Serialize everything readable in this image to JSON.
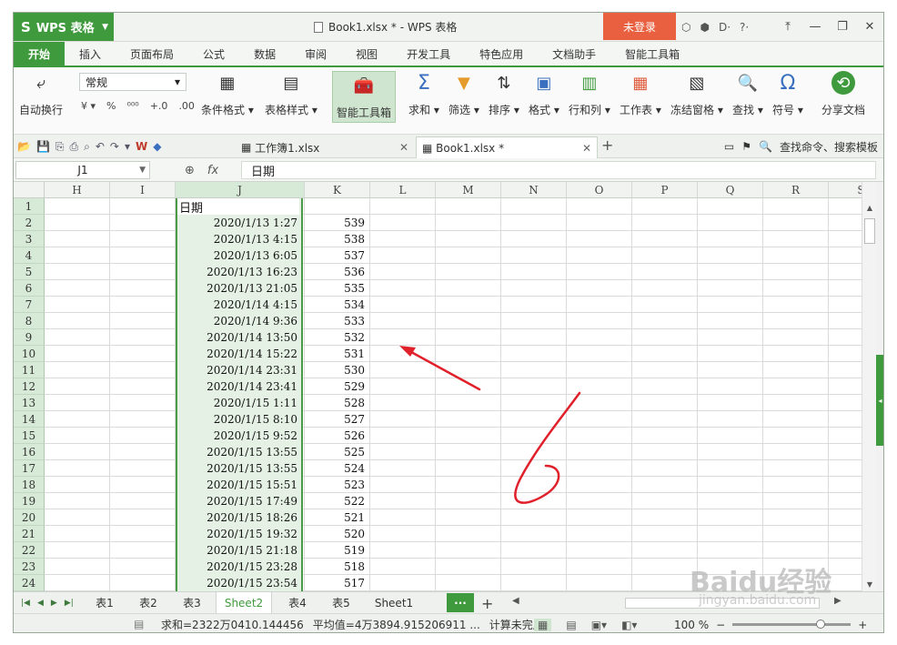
{
  "window": {
    "app_button": "WPS 表格",
    "title": "Book1.xlsx * - WPS 表格",
    "login_label": "未登录",
    "tool_glyphs": [
      "⬡",
      "⬢",
      "D·",
      "?·"
    ],
    "controls": [
      "⤒",
      "—",
      "❐",
      "✕"
    ]
  },
  "menu": {
    "tabs": [
      "开始",
      "插入",
      "页面布局",
      "公式",
      "数据",
      "审阅",
      "视图",
      "开发工具",
      "特色应用",
      "文档助手",
      "智能工具箱"
    ]
  },
  "ribbon": {
    "wrap_label": "自动换行",
    "number_format": "常规",
    "number_tools": [
      "¥ ▾",
      "%",
      "⁰⁰⁰",
      "+.0",
      ".00"
    ],
    "items": [
      {
        "label": "条件格式 ▾",
        "icon": "conditional-format-icon",
        "glyph": "▦"
      },
      {
        "label": "表格样式 ▾",
        "icon": "table-style-icon",
        "glyph": "▤"
      },
      {
        "label": "智能工具箱",
        "icon": "toolbox-icon",
        "glyph": "🧰"
      },
      {
        "label": "求和 ▾",
        "icon": "sum-icon",
        "glyph": "Σ"
      },
      {
        "label": "筛选 ▾",
        "icon": "filter-icon",
        "glyph": "▼"
      },
      {
        "label": "排序 ▾",
        "icon": "sort-icon",
        "glyph": "⇅"
      },
      {
        "label": "格式 ▾",
        "icon": "format-icon",
        "glyph": "▣"
      },
      {
        "label": "行和列 ▾",
        "icon": "rows-cols-icon",
        "glyph": "▥"
      },
      {
        "label": "工作表 ▾",
        "icon": "worksheet-icon",
        "glyph": "▦"
      },
      {
        "label": "冻结窗格 ▾",
        "icon": "freeze-icon",
        "glyph": "▧"
      },
      {
        "label": "查找 ▾",
        "icon": "find-icon",
        "glyph": "🔍"
      },
      {
        "label": "符号 ▾",
        "icon": "symbol-icon",
        "glyph": "Ω"
      },
      {
        "label": "分享文档",
        "icon": "share-icon",
        "glyph": "⟲"
      }
    ]
  },
  "files": {
    "tab1": "工作簿1.xlsx",
    "tab2": "Book1.xlsx *",
    "search": "查找命令、搜索模板"
  },
  "formula_bar": {
    "name_box": "J1",
    "fx": "fx",
    "content": "日期"
  },
  "sheet": {
    "columns": [
      "H",
      "I",
      "J",
      "K",
      "L",
      "M",
      "N",
      "O",
      "P",
      "Q",
      "R",
      "S"
    ],
    "rows": [
      {
        "n": "1",
        "j": "日期",
        "k": ""
      },
      {
        "n": "2",
        "j": "2020/1/13 1:27",
        "k": "539"
      },
      {
        "n": "3",
        "j": "2020/1/13 4:15",
        "k": "538"
      },
      {
        "n": "4",
        "j": "2020/1/13 6:05",
        "k": "537"
      },
      {
        "n": "5",
        "j": "2020/1/13 16:23",
        "k": "536"
      },
      {
        "n": "6",
        "j": "2020/1/13 21:05",
        "k": "535"
      },
      {
        "n": "7",
        "j": "2020/1/14 4:15",
        "k": "534"
      },
      {
        "n": "8",
        "j": "2020/1/14 9:36",
        "k": "533"
      },
      {
        "n": "9",
        "j": "2020/1/14 13:50",
        "k": "532"
      },
      {
        "n": "10",
        "j": "2020/1/14 15:22",
        "k": "531"
      },
      {
        "n": "11",
        "j": "2020/1/14 23:31",
        "k": "530"
      },
      {
        "n": "12",
        "j": "2020/1/14 23:41",
        "k": "529"
      },
      {
        "n": "13",
        "j": "2020/1/15 1:11",
        "k": "528"
      },
      {
        "n": "14",
        "j": "2020/1/15 8:10",
        "k": "527"
      },
      {
        "n": "15",
        "j": "2020/1/15 9:52",
        "k": "526"
      },
      {
        "n": "16",
        "j": "2020/1/15 13:55",
        "k": "525"
      },
      {
        "n": "17",
        "j": "2020/1/15 13:55",
        "k": "524"
      },
      {
        "n": "18",
        "j": "2020/1/15 15:51",
        "k": "523"
      },
      {
        "n": "19",
        "j": "2020/1/15 17:49",
        "k": "522"
      },
      {
        "n": "20",
        "j": "2020/1/15 18:26",
        "k": "521"
      },
      {
        "n": "21",
        "j": "2020/1/15 19:32",
        "k": "520"
      },
      {
        "n": "22",
        "j": "2020/1/15 21:18",
        "k": "519"
      },
      {
        "n": "23",
        "j": "2020/1/15 23:28",
        "k": "518"
      },
      {
        "n": "24",
        "j": "2020/1/15 23:54",
        "k": "517"
      }
    ]
  },
  "sheet_tabs": {
    "tabs": [
      "表1",
      "表2",
      "表3",
      "Sheet2",
      "表4",
      "表5",
      "Sheet1"
    ],
    "active": "Sheet2",
    "more": "···",
    "add": "+"
  },
  "status": {
    "sum": "求和=2322万0410.144456",
    "avg": "平均值=4万3894.915206911 ...",
    "calc": "计算未完成",
    "zoom": "100 %"
  },
  "watermark": {
    "brand": "Baidu经验",
    "url": "jingyan.baidu.com"
  },
  "colors": {
    "accent": "#3e9a3c",
    "login": "#e86040",
    "annotation": "#e0202a"
  }
}
